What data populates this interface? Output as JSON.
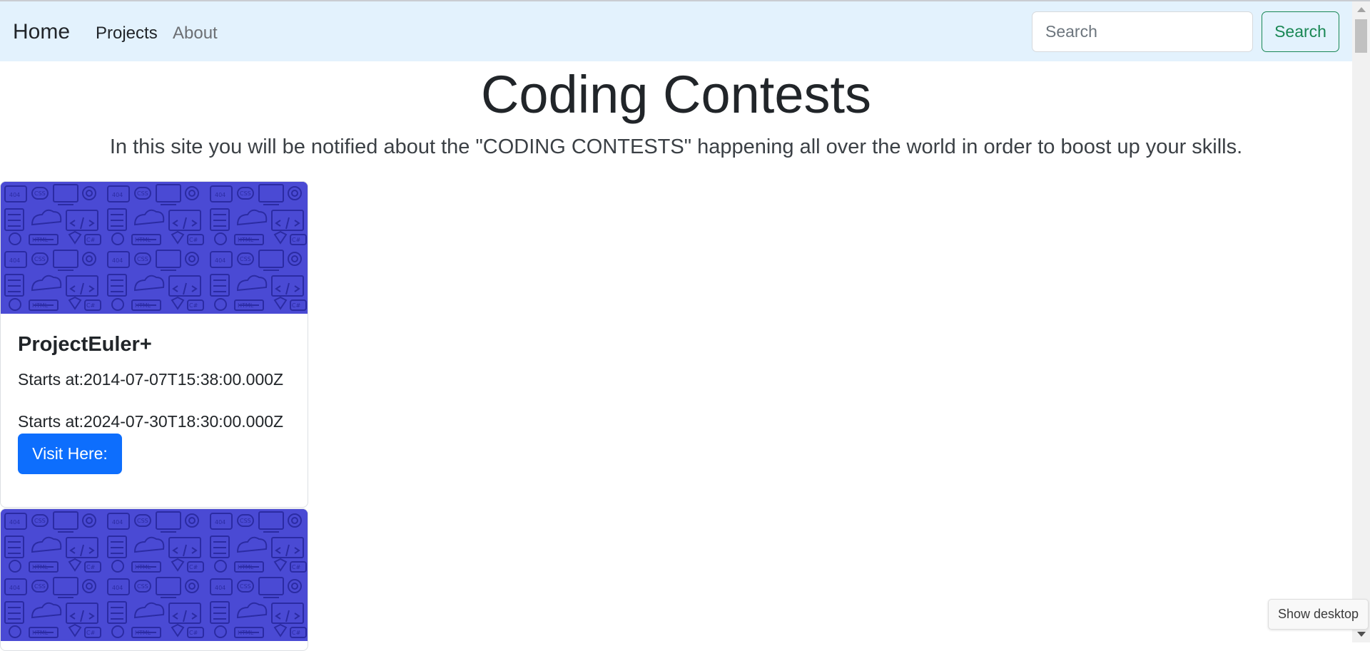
{
  "navbar": {
    "brand": "Home",
    "links": [
      {
        "label": "Projects"
      },
      {
        "label": "About"
      }
    ],
    "search": {
      "placeholder": "Search",
      "button_label": "Search"
    },
    "background_color": "#e3f2fd"
  },
  "hero": {
    "title": "Coding Contests",
    "lead": "In this site you will be notified about the \"CODING CONTESTS\" happening all over the world in order to boost up your skills."
  },
  "contests": [
    {
      "name": "ProjectEuler+",
      "start_text": "Starts at:2014-07-07T15:38:00.000Z",
      "end_text": "Starts at:2024-07-30T18:30:00.000Z",
      "button_label": "Visit Here:",
      "image_icon": "coding-pattern-image"
    },
    {
      "image_icon": "coding-pattern-image"
    }
  ],
  "taskbar": {
    "show_desktop_label": "Show desktop"
  },
  "colors": {
    "primary_button": "#0d6efd",
    "success_outline": "#198754",
    "card_image_bg": "#4a4ad4"
  }
}
